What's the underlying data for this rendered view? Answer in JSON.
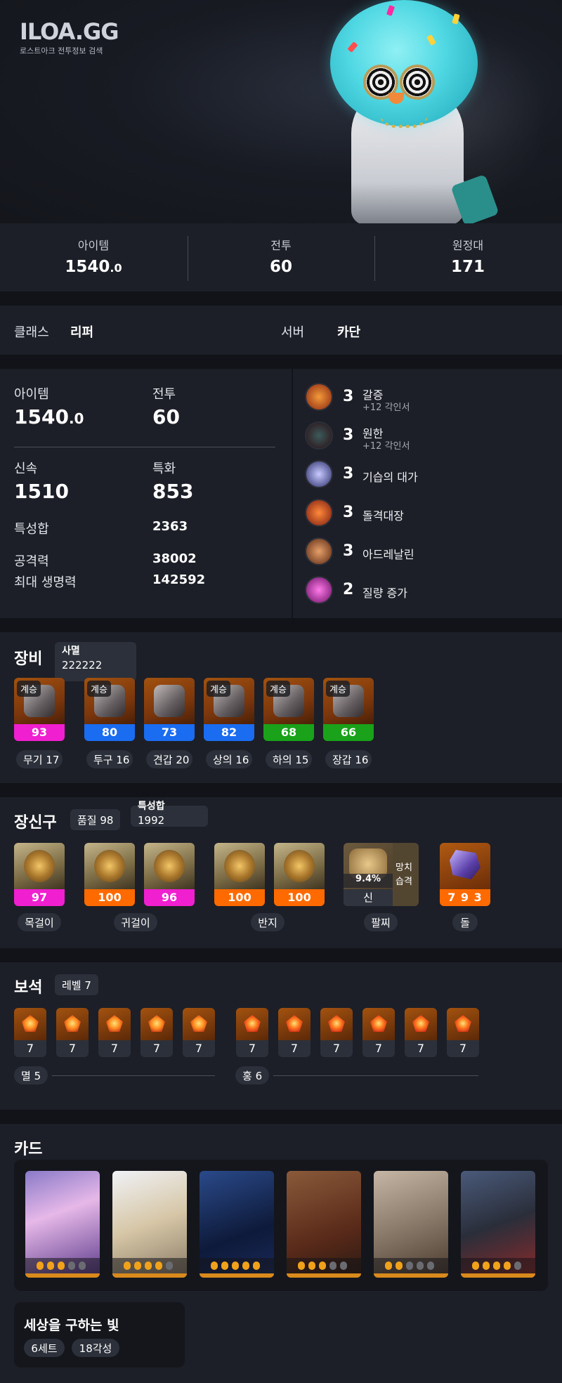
{
  "header": {
    "logo": "ILOA.GG",
    "subtitle": "로스트아크 전투정보 검색"
  },
  "top_stats": [
    {
      "label": "아이템",
      "value_main": "1540",
      "value_dec": ".0"
    },
    {
      "label": "전투",
      "value": "60"
    },
    {
      "label": "원정대",
      "value": "171"
    }
  ],
  "class_row": {
    "class_label": "클래스",
    "class_value": "리퍼",
    "server_label": "서버",
    "server_value": "카단"
  },
  "stats": {
    "item_label": "아이템",
    "item_main": "1540",
    "item_dec": ".0",
    "combat_label": "전투",
    "combat_value": "60",
    "swift_label": "신속",
    "swift_value": "1510",
    "crit_label": "특화",
    "crit_value": "853",
    "trait_label": "특성합",
    "trait_value": "2363",
    "atk_label": "공격력",
    "atk_value": "38002",
    "hp_label": "최대 생명력",
    "hp_value": "142592"
  },
  "engravings": [
    {
      "level": "3",
      "name": "갈증",
      "sub": "+12 각인서",
      "color": "#b2441a"
    },
    {
      "level": "3",
      "name": "원한",
      "sub": "+12 각인서",
      "color": "#5a1d24"
    },
    {
      "level": "3",
      "name": "기습의 대가",
      "sub": "",
      "color": "#4a4c8a"
    },
    {
      "level": "3",
      "name": "돌격대장",
      "sub": "",
      "color": "#b8341d"
    },
    {
      "level": "3",
      "name": "아드레날린",
      "sub": "",
      "color": "#8a4a22"
    },
    {
      "level": "2",
      "name": "질량 증가",
      "sub": "",
      "color": "#b22aa8"
    }
  ],
  "equipment": {
    "title": "장비",
    "grade_label": "사멸",
    "grade_value": "222222",
    "items": [
      {
        "tag": "계승",
        "quality": "93",
        "color": "#f01fd0",
        "caption": "무기 17",
        "icon": "weapon-scythe-icon"
      },
      {
        "tag": "계승",
        "quality": "80",
        "color": "#1a6cf0",
        "caption": "투구 16",
        "icon": "helmet-icon"
      },
      {
        "tag": "",
        "quality": "73",
        "color": "#1a6cf0",
        "caption": "견갑 20",
        "icon": "shoulder-icon"
      },
      {
        "tag": "계승",
        "quality": "82",
        "color": "#1a6cf0",
        "caption": "상의 16",
        "icon": "chest-armor-icon"
      },
      {
        "tag": "계승",
        "quality": "68",
        "color": "#19a21a",
        "caption": "하의 15",
        "icon": "pants-icon"
      },
      {
        "tag": "계승",
        "quality": "66",
        "color": "#19a21a",
        "caption": "장갑 16",
        "icon": "gloves-icon"
      }
    ]
  },
  "accessories": {
    "title": "장신구",
    "quality_pill": "품질 98",
    "trait_label": "특성합",
    "trait_value": "1992",
    "items": [
      {
        "quality": "97",
        "color": "#f01fd0",
        "icon": "necklace-icon"
      },
      {
        "quality": "100",
        "color": "#ff6a00",
        "icon": "earring-icon"
      },
      {
        "quality": "96",
        "color": "#f01fd0",
        "icon": "earring-icon"
      },
      {
        "quality": "100",
        "color": "#ff6a00",
        "icon": "ring-icon"
      },
      {
        "quality": "100",
        "color": "#ff6a00",
        "icon": "ring-icon"
      }
    ],
    "captions": [
      "목걸이",
      "귀걸이",
      "반지",
      "팔찌",
      "돌"
    ],
    "bracelet": {
      "percent": "9.4%",
      "type": "신",
      "effect_line1": "망치",
      "effect_line2": "습격"
    },
    "stone": {
      "value": "7 9 3"
    }
  },
  "gems": {
    "title": "보석",
    "level_pill": "레벨 7",
    "left_levels": [
      "7",
      "7",
      "7",
      "7",
      "7"
    ],
    "right_levels": [
      "7",
      "7",
      "7",
      "7",
      "7",
      "7"
    ],
    "left_label": "멸 5",
    "right_label": "홍 6"
  },
  "cards": {
    "title": "카드",
    "items": [
      {
        "awaken": 3,
        "icon": "card-twin-goddess-icon"
      },
      {
        "awaken": 4,
        "icon": "card-angel-icon"
      },
      {
        "awaken": 5,
        "icon": "card-dark-knight-icon"
      },
      {
        "awaken": 3,
        "icon": "card-warrior-king-icon"
      },
      {
        "awaken": 2,
        "icon": "card-paladin-icon"
      },
      {
        "awaken": 4,
        "icon": "card-moon-mage-icon"
      }
    ],
    "set_name": "세상을 구하는 빛",
    "set_count": "6세트",
    "set_awaken": "18각성"
  }
}
